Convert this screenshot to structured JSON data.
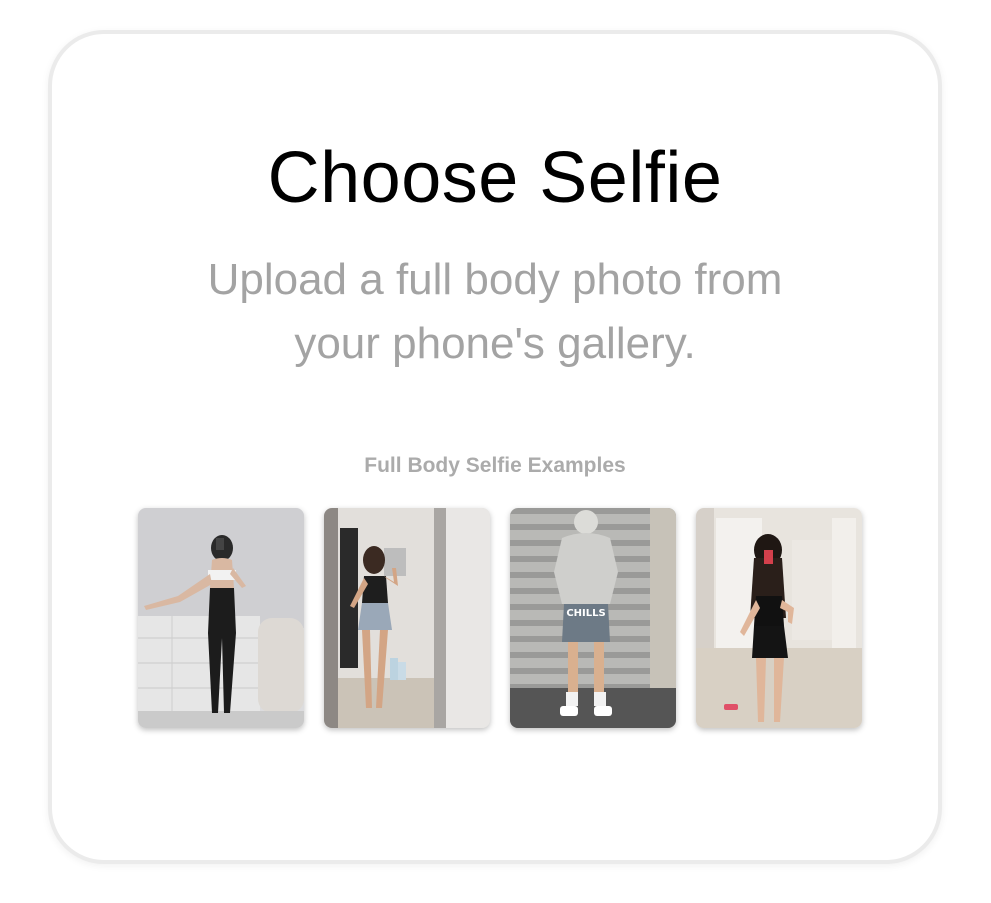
{
  "card": {
    "title": "Choose Selfie",
    "subtitle_line1": "Upload a full body photo from",
    "subtitle_line2": "your phone's gallery.",
    "examples_label": "Full Body Selfie Examples"
  },
  "examples": [
    {
      "name": "example-photo-1",
      "shirt_text": ""
    },
    {
      "name": "example-photo-2",
      "shirt_text": ""
    },
    {
      "name": "example-photo-3",
      "shirt_text": "CHILLS"
    },
    {
      "name": "example-photo-4",
      "shirt_text": ""
    }
  ],
  "colors": {
    "title": "#000000",
    "subtitle": "#a3a3a3",
    "label": "#ababab",
    "card_border": "#ebebeb"
  }
}
